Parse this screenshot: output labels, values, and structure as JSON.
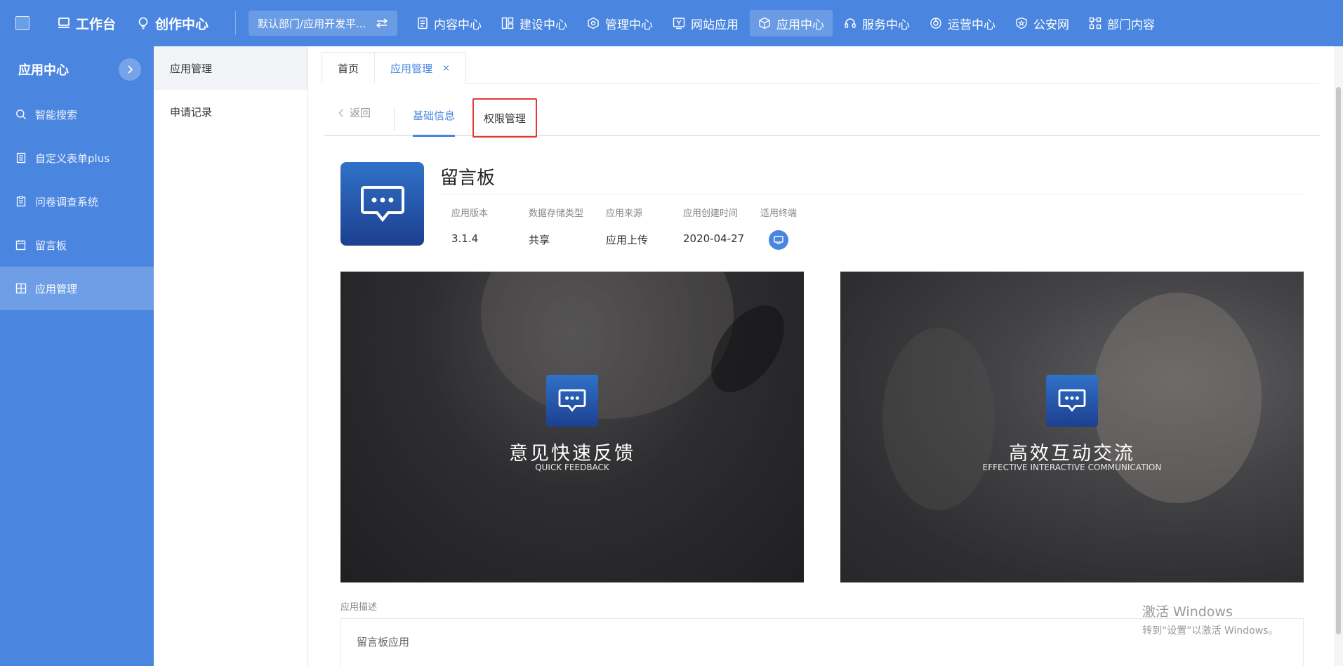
{
  "topbar": {
    "workbench": "工作台",
    "creation_center": "创作中心",
    "department": "默认部门/应用开发平...",
    "nav": [
      {
        "label": "内容中心"
      },
      {
        "label": "建设中心"
      },
      {
        "label": "管理中心"
      },
      {
        "label": "网站应用"
      },
      {
        "label": "应用中心"
      },
      {
        "label": "服务中心"
      },
      {
        "label": "运营中心"
      },
      {
        "label": "公安网"
      },
      {
        "label": "部门内容"
      }
    ]
  },
  "sidebar": {
    "title": "应用中心",
    "items": [
      {
        "label": "智能搜索"
      },
      {
        "label": "自定义表单plus"
      },
      {
        "label": "问卷调查系统"
      },
      {
        "label": "留言板"
      },
      {
        "label": "应用管理"
      }
    ]
  },
  "subsidebar": {
    "items": [
      {
        "label": "应用管理"
      },
      {
        "label": "申请记录"
      }
    ]
  },
  "tabs": {
    "home": "首页",
    "current": "应用管理",
    "close": "×"
  },
  "subtabs": {
    "back": "返回",
    "info": "基础信息",
    "permission": "权限管理"
  },
  "app": {
    "name": "留言板",
    "meta": [
      {
        "label": "应用版本",
        "value": "3.1.4"
      },
      {
        "label": "数据存储类型",
        "value": "共享"
      },
      {
        "label": "应用来源",
        "value": "应用上传"
      },
      {
        "label": "应用创建时间",
        "value": "2020-04-27"
      },
      {
        "label": "适用终端",
        "value": ""
      }
    ]
  },
  "banners": [
    {
      "title": "意见快速反馈",
      "subtitle": "QUICK FEEDBACK"
    },
    {
      "title": "高效互动交流",
      "subtitle": "EFFECTIVE INTERACTIVE COMMUNICATION"
    }
  ],
  "description": {
    "label": "应用描述",
    "value": "留言板应用"
  },
  "watermark": {
    "line1": "激活 Windows",
    "line2": "转到“设置”以激活 Windows。"
  },
  "colors": {
    "primary": "#4a86e0",
    "highlight_box": "#e53935"
  }
}
